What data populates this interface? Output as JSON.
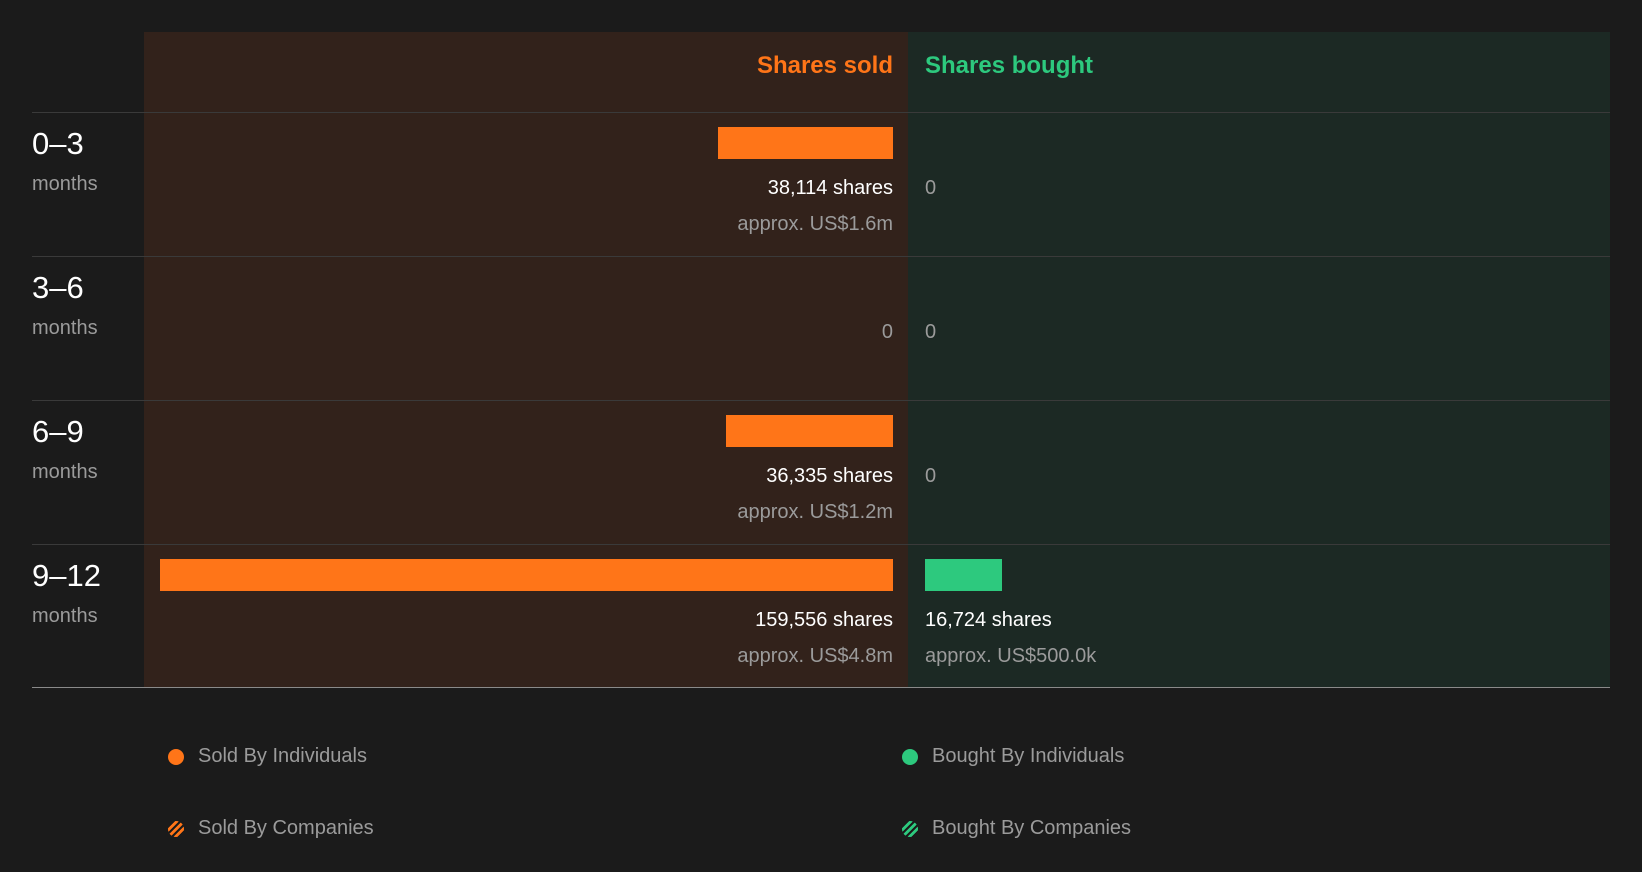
{
  "chart_data": {
    "type": "bar",
    "headers": {
      "sold": "Shares sold",
      "bought": "Shares bought"
    },
    "rows": [
      {
        "range": "0–3",
        "unit": "months",
        "sold_shares": 38114,
        "sold_shares_text": "38,114 shares",
        "sold_approx": "approx. US$1.6m",
        "bought_shares": 0,
        "bought_shares_text": "0",
        "bought_approx": ""
      },
      {
        "range": "3–6",
        "unit": "months",
        "sold_shares": 0,
        "sold_shares_text": "0",
        "sold_approx": "",
        "bought_shares": 0,
        "bought_shares_text": "0",
        "bought_approx": ""
      },
      {
        "range": "6–9",
        "unit": "months",
        "sold_shares": 36335,
        "sold_shares_text": "36,335 shares",
        "sold_approx": "approx. US$1.2m",
        "bought_shares": 0,
        "bought_shares_text": "0",
        "bought_approx": ""
      },
      {
        "range": "9–12",
        "unit": "months",
        "sold_shares": 159556,
        "sold_shares_text": "159,556 shares",
        "sold_approx": "approx. US$4.8m",
        "bought_shares": 16724,
        "bought_shares_text": "16,724 shares",
        "bought_approx": "approx. US$500.0k"
      }
    ],
    "legend": [
      {
        "label": "Sold By Individuals",
        "style": "solid",
        "color": "#ff7518"
      },
      {
        "label": "Bought By Individuals",
        "style": "solid",
        "color": "#2dc97e"
      },
      {
        "label": "Sold By Companies",
        "style": "hatched",
        "color": "#ff7518"
      },
      {
        "label": "Bought By Companies",
        "style": "hatched",
        "color": "#2dc97e"
      }
    ],
    "colors": {
      "sold": "#ff7518",
      "bought": "#2dc97e",
      "sold_bg": "#32221b",
      "bought_bg": "#1c2924"
    }
  }
}
